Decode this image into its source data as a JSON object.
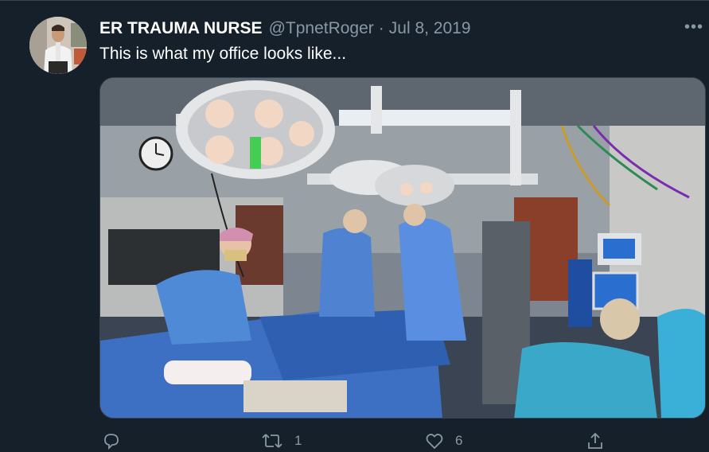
{
  "tweet": {
    "author_name": "ER TRAUMA NURSE",
    "author_handle": "@TpnetRoger",
    "separator": "·",
    "date": "Jul 8, 2019",
    "text": "This is what my office looks like...",
    "more_label": "•••"
  },
  "media": {
    "alt": "Surgical team in blue scrubs operating under large surgical lights in an operating room"
  },
  "actions": {
    "reply": {
      "icon": "reply-icon",
      "count": ""
    },
    "retweet": {
      "icon": "retweet-icon",
      "count": "1"
    },
    "like": {
      "icon": "heart-icon",
      "count": "6"
    },
    "share": {
      "icon": "share-icon",
      "count": ""
    }
  },
  "colors": {
    "background": "#15202b",
    "primary_text": "#ffffff",
    "secondary_text": "#8899a6",
    "border": "#38444d"
  }
}
